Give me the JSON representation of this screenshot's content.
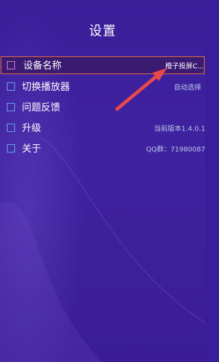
{
  "title": "设置",
  "menu": [
    {
      "label": "设备名称",
      "value": "橙子投屏C...",
      "icon": "edit-icon"
    },
    {
      "label": "切换播放器",
      "value": "自动选择",
      "icon": "play-next-icon"
    },
    {
      "label": "问题反馈",
      "value": "",
      "icon": "feedback-icon"
    },
    {
      "label": "升级",
      "value": "当前版本1.4.0.1",
      "icon": "upgrade-icon"
    },
    {
      "label": "关于",
      "value": "QQ群：71980087",
      "icon": "info-icon"
    }
  ],
  "colors": {
    "background": "#3a1d99",
    "selected_border": "#e8703a",
    "arrow": "#e9484a"
  }
}
